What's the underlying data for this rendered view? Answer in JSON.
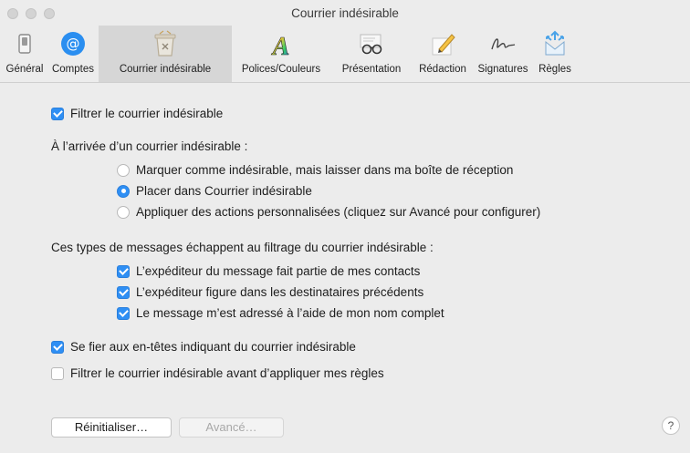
{
  "window": {
    "title": "Courrier indésirable",
    "traffic_lights": [
      "close",
      "minimize",
      "zoom"
    ]
  },
  "toolbar": {
    "tabs": [
      {
        "label": "Général",
        "icon": "switch-icon",
        "selected": false
      },
      {
        "label": "Comptes",
        "icon": "at-sign-icon",
        "selected": false
      },
      {
        "label": "Courrier indésirable",
        "icon": "junk-trash-icon",
        "selected": true
      },
      {
        "label": "Polices/Couleurs",
        "icon": "font-colors-icon",
        "selected": false
      },
      {
        "label": "Présentation",
        "icon": "glasses-icon",
        "selected": false
      },
      {
        "label": "Rédaction",
        "icon": "pencil-icon",
        "selected": false
      },
      {
        "label": "Signatures",
        "icon": "signature-icon",
        "selected": false
      },
      {
        "label": "Règles",
        "icon": "rules-envelope-icon",
        "selected": false
      }
    ]
  },
  "junk": {
    "enable_filter": {
      "label": "Filtrer le courrier indésirable",
      "checked": true
    },
    "arrival_heading": "À l’arrivée d’un courrier indésirable :",
    "arrival_options": [
      {
        "label": "Marquer comme indésirable, mais laisser dans ma boîte de réception",
        "selected": false
      },
      {
        "label": "Placer dans Courrier indésirable",
        "selected": true
      },
      {
        "label": "Appliquer des actions personnalisées (cliquez sur Avancé pour configurer)",
        "selected": false
      }
    ],
    "exempt_heading": "Ces types de messages échappent au filtrage du courrier indésirable :",
    "exempt_options": [
      {
        "label": "L’expéditeur du message fait partie de mes contacts",
        "checked": true
      },
      {
        "label": "L’expéditeur figure dans les destinataires précédents",
        "checked": true
      },
      {
        "label": "Le message m’est adressé à l’aide de mon nom complet",
        "checked": true
      }
    ],
    "trust_headers": {
      "label": "Se fier aux en-têtes indiquant du courrier indésirable",
      "checked": true
    },
    "filter_before_rules": {
      "label": "Filtrer le courrier indésirable avant d’appliquer mes règles",
      "checked": false
    }
  },
  "buttons": {
    "reset_label": "Réinitialiser…",
    "advanced_label": "Avancé…",
    "help_label": "?"
  },
  "colors": {
    "accent": "#2f8ff4",
    "window_bg": "#ececec",
    "selected_tab_bg": "#d6d6d6"
  }
}
